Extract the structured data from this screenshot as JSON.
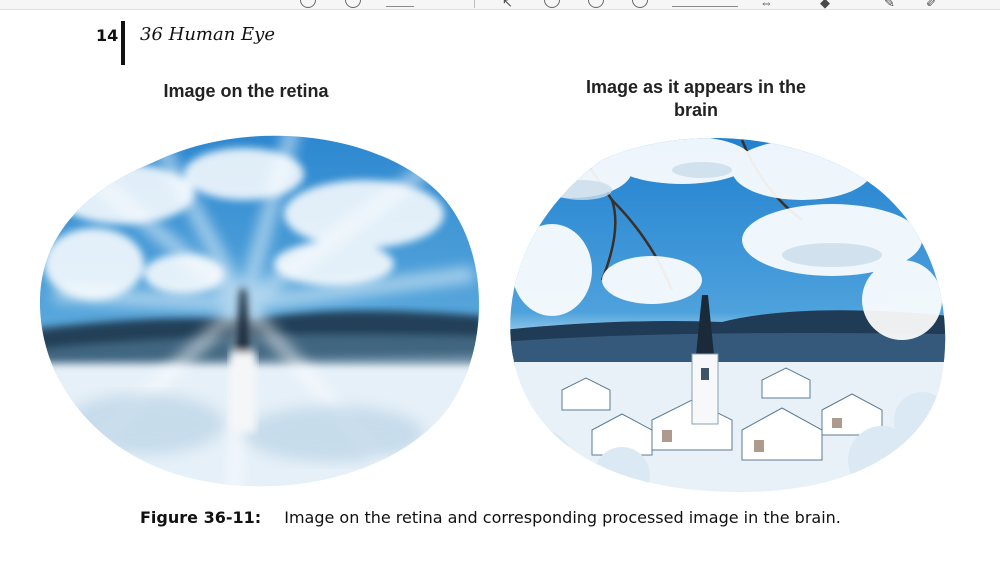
{
  "header": {
    "page_number": "14",
    "chapter_title": "36 Human Eye"
  },
  "panels": {
    "left_caption": "Image on the retina",
    "right_caption_line1": "Image as it appears in the",
    "right_caption_line2": "brain"
  },
  "figure": {
    "label": "Figure 36-11:",
    "caption": "Image on the retina and corresponding processed image in the brain."
  },
  "colors": {
    "sky": "#2f8fd8",
    "snow": "#eef5fb",
    "hills": "#1f3b55"
  }
}
